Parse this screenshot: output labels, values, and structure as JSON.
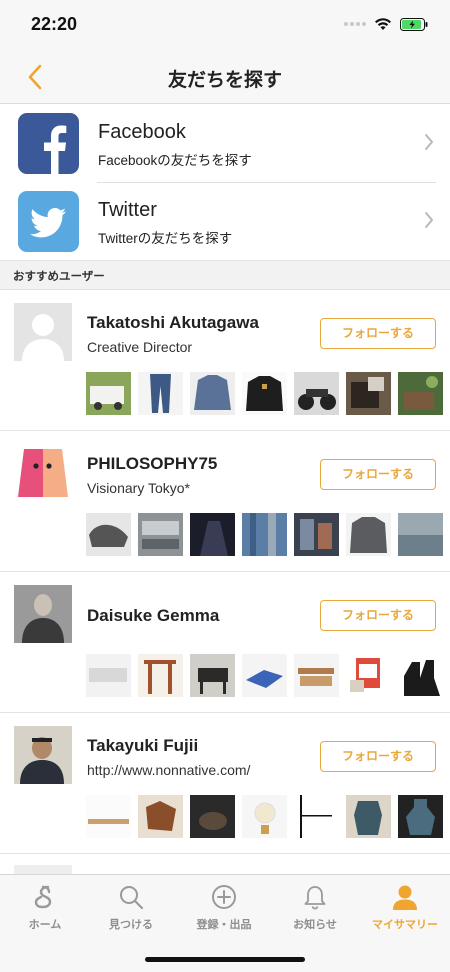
{
  "status": {
    "time": "22:20"
  },
  "nav": {
    "title": "友だちを探す"
  },
  "social": [
    {
      "name": "Facebook",
      "sub": "Facebookの友だちを探す",
      "brand_color": "#3b5998"
    },
    {
      "name": "Twitter",
      "sub": "Twitterの友だちを探す",
      "brand_color": "#5aa8e0"
    }
  ],
  "section": {
    "recommended": "おすすめユーザー"
  },
  "follow_label": "フォローする",
  "users": [
    {
      "name": "Takatoshi Akutagawa",
      "desc": "Creative Director",
      "avatar": "default-avatar"
    },
    {
      "name": "PHILOSOPHY75",
      "desc": "Visionary Tokyo*",
      "avatar": "philosophy-logo"
    },
    {
      "name": "Daisuke Gemma",
      "desc": "",
      "avatar": "photo"
    },
    {
      "name": "Takayuki Fujii",
      "desc": "http://www.nonnative.com/",
      "avatar": "photo"
    }
  ],
  "tabs": [
    {
      "label": "ホーム",
      "icon": "home-s-icon"
    },
    {
      "label": "見つける",
      "icon": "search-icon"
    },
    {
      "label": "登録・出品",
      "icon": "plus-circle-icon"
    },
    {
      "label": "お知らせ",
      "icon": "bell-icon"
    },
    {
      "label": "マイサマリー",
      "icon": "person-icon",
      "active": true
    }
  ],
  "colors": {
    "accent": "#f0a531",
    "follow": "#e8a83b"
  }
}
